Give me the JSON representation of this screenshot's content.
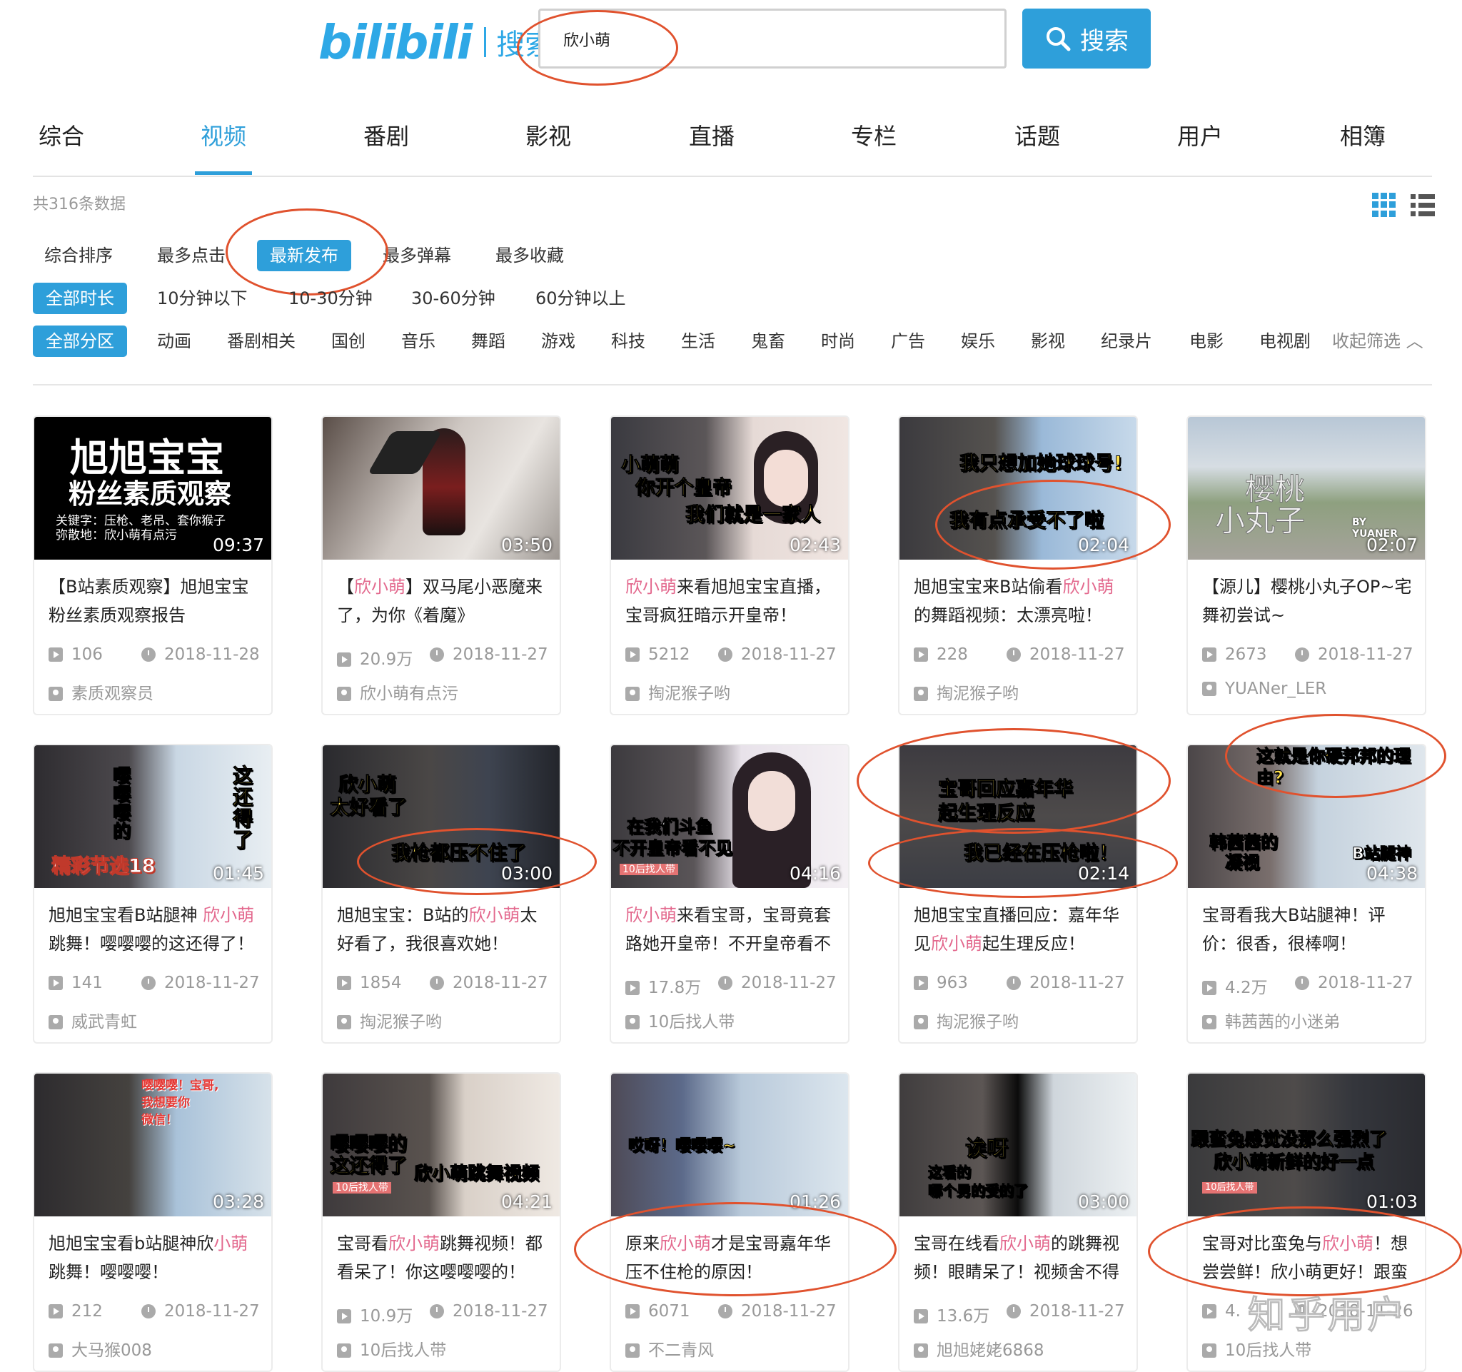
{
  "header": {
    "logo_text": "bilibili",
    "logo_sub": "搜索",
    "search_value": "欣小萌",
    "search_button": "搜索"
  },
  "tabs": [
    "综合",
    "视频",
    "番剧",
    "影视",
    "直播",
    "专栏",
    "话题",
    "用户",
    "相簿"
  ],
  "active_tab": "视频",
  "result_count": "共316条数据",
  "sort": [
    "综合排序",
    "最多点击",
    "最新发布",
    "最多弹幕",
    "最多收藏"
  ],
  "duration": [
    "全部时长",
    "10分钟以下",
    "10-30分钟",
    "30-60分钟",
    "60分钟以上"
  ],
  "zones": [
    "全部分区",
    "动画",
    "番剧相关",
    "国创",
    "音乐",
    "舞蹈",
    "游戏",
    "科技",
    "生活",
    "鬼畜",
    "时尚",
    "广告",
    "娱乐",
    "影视",
    "纪录片",
    "电影",
    "电视剧"
  ],
  "collapse_label": "收起筛选",
  "colors": {
    "accent": "#2e9fda",
    "highlight": "#e3698e",
    "annotation": "#e0522e"
  },
  "videos": [
    {
      "duration": "09:37",
      "title_pre": "【B站素质观察】旭旭宝宝粉丝素质观察报告",
      "title_hl": "",
      "title_post": "",
      "plays": "106",
      "date": "2018-11-28",
      "author": "素质观察员",
      "cap1": "旭旭宝宝",
      "cap2": "粉丝素质观察",
      "cap3": "关键字：压枪、老吊、套你猴子",
      "cap4": "弥散地：欣小萌有点污"
    },
    {
      "duration": "03:50",
      "title_pre": "【",
      "title_hl": "欣小萌",
      "title_post": "】双马尾小恶魔来了，为你《着魔》",
      "plays": "20.9万",
      "date": "2018-11-27",
      "author": "欣小萌有点污"
    },
    {
      "duration": "02:43",
      "title_pre": "",
      "title_hl": "欣小萌",
      "title_post": "来看旭旭宝宝直播，宝哥疯狂暗示开皇帝！",
      "plays": "5212",
      "date": "2018-11-27",
      "author": "掏泥猴子哟",
      "cap1": "小萌萌",
      "cap2": "你开个皇帝",
      "cap3": "我们就是一家人"
    },
    {
      "duration": "02:04",
      "title_pre": "旭旭宝宝来B站偷看",
      "title_hl": "欣小萌",
      "title_post": "的舞蹈视频：太漂亮啦！",
      "plays": "228",
      "date": "2018-11-27",
      "author": "掏泥猴子哟",
      "cap1": "我只想加她球球号!",
      "cap2": "我有点承受不了啦"
    },
    {
      "duration": "02:07",
      "title_pre": "【源儿】樱桃小丸子OP~宅舞初尝试~",
      "title_hl": "",
      "title_post": "",
      "plays": "2673",
      "date": "2018-11-27",
      "author": "YUANer_LER",
      "cap1": "樱桃",
      "cap2": "小丸子",
      "cap3": "BY YUANER"
    },
    {
      "duration": "01:45",
      "title_pre": "旭旭宝宝看B站腿神 ",
      "title_hl": "欣小萌",
      "title_post": "跳舞！嘤嘤嘤的这还得了！",
      "plays": "141",
      "date": "2018-11-27",
      "author": "威武青虹",
      "cap1": "精彩节选18",
      "cap2": "嘤嘤嘤的",
      "cap3": "这还得了"
    },
    {
      "duration": "03:00",
      "title_pre": "旭旭宝宝：B站的",
      "title_hl": "欣小萌",
      "title_post": "太好看了，我很喜欢她！",
      "plays": "1854",
      "date": "2018-11-27",
      "author": "掏泥猴子哟",
      "cap1": "欣小萌",
      "cap2": "太好看了",
      "cap3": "我枪都压不住了"
    },
    {
      "duration": "04:16",
      "title_pre": "",
      "title_hl": "欣小萌",
      "title_post": "来看宝哥，宝哥竟套路她开皇帝！不开皇帝看不",
      "plays": "17.8万",
      "date": "2018-11-27",
      "author": "10后找人带",
      "cap1": "在我们斗鱼",
      "cap2": "不开皇帝看不见",
      "cap3": "10后找人带"
    },
    {
      "duration": "02:14",
      "title_pre": "旭旭宝宝直播回应：嘉年华见",
      "title_hl": "欣小萌",
      "title_post": "起生理反应！",
      "plays": "963",
      "date": "2018-11-27",
      "author": "掏泥猴子哟",
      "cap1": "宝哥回应嘉年华",
      "cap2": "起生理反应",
      "cap3": "我已经在压枪啦！"
    },
    {
      "duration": "04:38",
      "title_pre": "宝哥看我大B站腿神！评价：很香，很棒啊！",
      "title_hl": "",
      "title_post": "",
      "plays": "4.2万",
      "date": "2018-11-27",
      "author": "韩茜茜的小迷弟",
      "cap1": "这就是你硬邦邦的理由?",
      "cap2": "韩茜茜的",
      "cap3": "凝视",
      "cap4": "B站腿神"
    },
    {
      "duration": "03:28",
      "title_pre": "旭旭宝宝看b站腿神欣",
      "title_hl": "小萌",
      "title_post": "跳舞！嘤嘤嘤！",
      "plays": "212",
      "date": "2018-11-27",
      "author": "大马猴008",
      "cap1": "嘤嘤嘤！宝哥,",
      "cap2": "我想要你",
      "cap3": "微信！"
    },
    {
      "duration": "04:21",
      "title_pre": "宝哥看",
      "title_hl": "欣小萌",
      "title_post": "跳舞视频！都看呆了！你这嘤嘤嘤的！",
      "plays": "10.9万",
      "date": "2018-11-27",
      "author": "10后找人带",
      "cap1": "嘤嘤嘤的",
      "cap2": "这还得了",
      "cap3": "欣小萌跳舞视频",
      "cap4": "10后找人带"
    },
    {
      "duration": "01:26",
      "title_pre": "原来",
      "title_hl": "欣小萌",
      "title_post": "才是宝哥嘉年华压不住枪的原因！",
      "plays": "6071",
      "date": "2018-11-27",
      "author": "不二青风",
      "cap1": "哎呀！嘤嘤嘤~"
    },
    {
      "duration": "03:00",
      "title_pre": "宝哥在线看",
      "title_hl": "欣小萌",
      "title_post": "的跳舞视频！眼睛呆了！视频舍不得",
      "plays": "13.6万",
      "date": "2018-11-27",
      "author": "旭旭姥姥6868",
      "cap1": "诶呀",
      "cap2": "这看的",
      "cap3": "哪个男的受的了"
    },
    {
      "duration": "01:03",
      "title_pre": "宝哥对比蛮兔与",
      "title_hl": "欣小萌",
      "title_post": "！想尝尝鲜！欣小萌更好！跟蛮",
      "plays": "4.",
      "date": "2018-11-26",
      "author": "10后找人带",
      "cap1": "跟蛮兔感觉没那么强烈了",
      "cap2": "欣小萌新鲜的好一点",
      "cap3": "10后找人带"
    }
  ],
  "watermark": "知乎用户"
}
